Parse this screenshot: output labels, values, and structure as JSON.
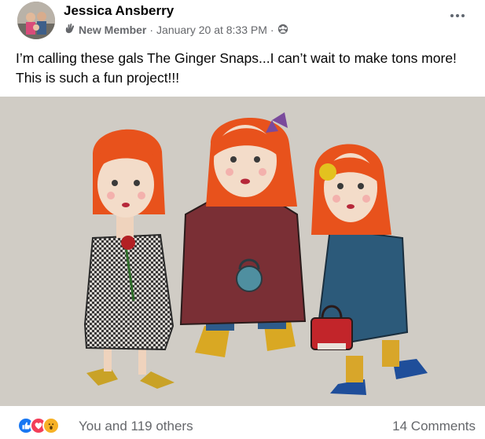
{
  "post": {
    "author": "Jessica Ansberry",
    "badge": "New Member",
    "timestamp": "January 20 at 8:33 PM",
    "separator": "·",
    "privacy_icon": "group-audience-icon",
    "caption": "I’m calling these gals The Ginger Snaps...I can’t wait to make tons more! This is such a fun project!!!"
  },
  "footer": {
    "reactions": [
      "like-icon",
      "love-icon",
      "wow-icon"
    ],
    "reaction_text": "You and 119 others",
    "comments": "14 Comments"
  },
  "colors": {
    "text_primary": "#050505",
    "text_secondary": "#65676b",
    "like": "#1877f2",
    "love": "#f33e58",
    "wow": "#f7b125",
    "hair": "#e8521c"
  }
}
